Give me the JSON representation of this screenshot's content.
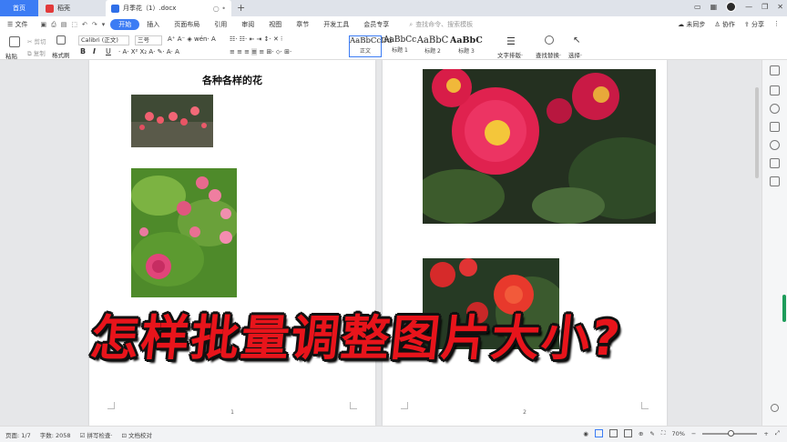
{
  "tabs": {
    "home": "首页",
    "shell": "稻壳",
    "doc": "月季花（1）.docx"
  },
  "window": {
    "unsynced": "未同步",
    "collab": "协作",
    "share": "分享"
  },
  "menu": {
    "file": "文件",
    "items": [
      "开始",
      "插入",
      "页面布局",
      "引用",
      "审阅",
      "视图",
      "章节",
      "开发工具",
      "会员专享"
    ],
    "search_placeholder": "查找命令、搜索模板"
  },
  "ribbon": {
    "paste": "粘贴",
    "cut": "剪切",
    "copy": "复制",
    "format_painter": "格式刷",
    "font": "Calibri (正文)",
    "size": "三号",
    "styles": [
      {
        "sample": "AaBbCcDd",
        "name": "正文"
      },
      {
        "sample": "AaBbCc",
        "name": "标题 1"
      },
      {
        "sample": "AaBbC",
        "name": "标题 2"
      },
      {
        "sample": "AaBbCc",
        "name": "标题 3"
      }
    ],
    "text_layout": "文字排版",
    "find_replace": "查找替换",
    "select": "选择"
  },
  "document": {
    "title": "各种各样的花",
    "page1_num": "1",
    "page2_num": "2",
    "caption": "怎样批量调整图片大小?"
  },
  "status": {
    "page": "页面: 1/7",
    "words": "字数: 2058",
    "spell": "拼写检查",
    "proof": "文档校对",
    "zoom": "70%"
  }
}
